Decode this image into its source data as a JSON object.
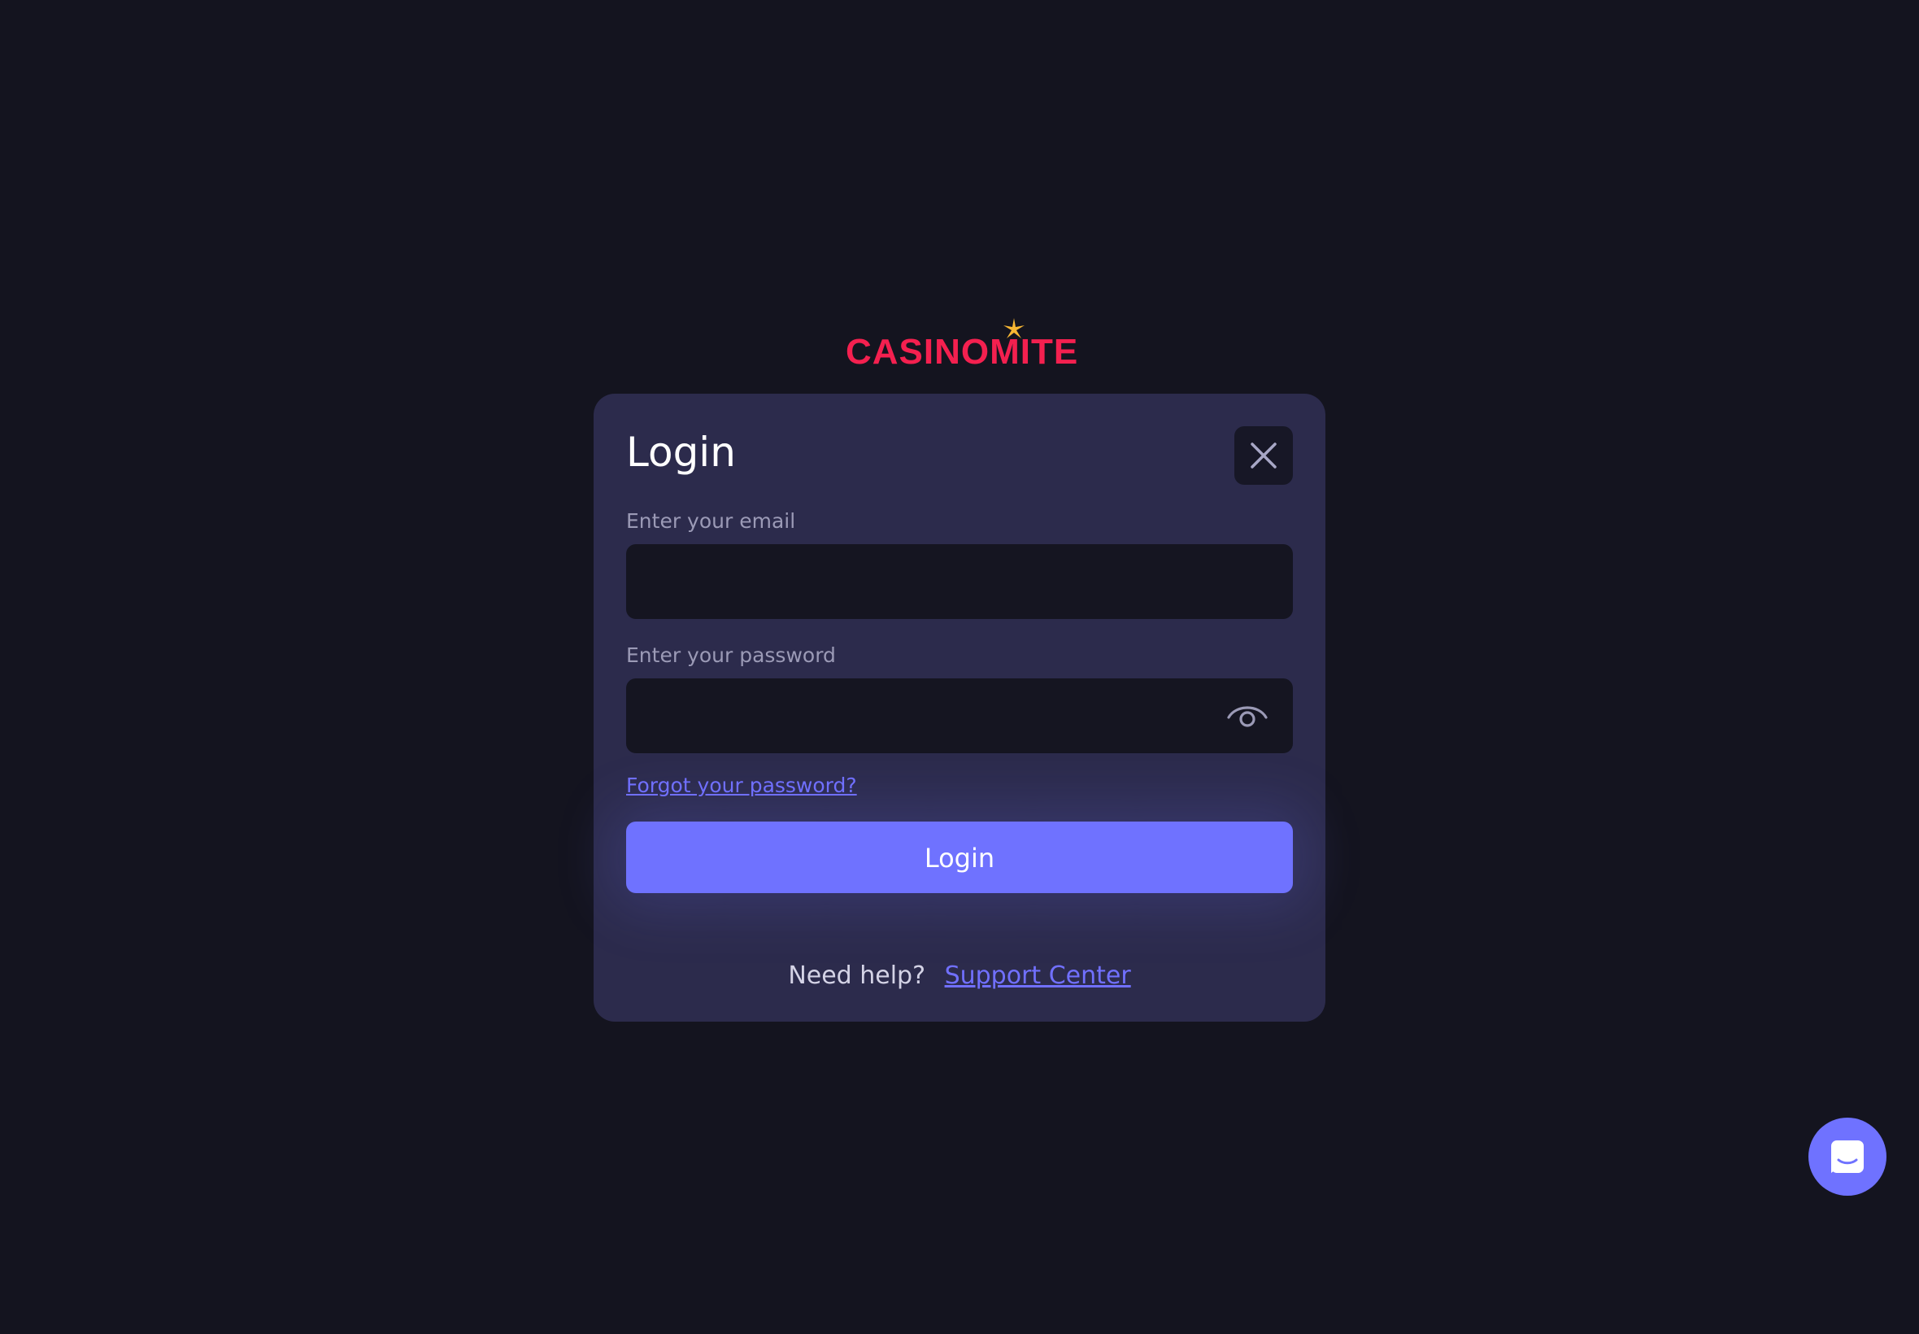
{
  "brand": {
    "logo_text": "CASINOMITE",
    "logo_color": "#f4204f",
    "star_color": "#f7b733"
  },
  "login_modal": {
    "title": "Login",
    "close_icon": "close-icon",
    "email_label": "Enter your email",
    "email_value": "",
    "password_label": "Enter your password",
    "password_value": "",
    "password_toggle_icon": "eye-icon",
    "forgot_password_link": "Forgot your password?",
    "submit_label": "Login",
    "help_text": "Need help?",
    "support_link": "Support Center"
  },
  "chat": {
    "icon": "chat-icon"
  },
  "colors": {
    "background": "#14141f",
    "modal_background": "#2c2b4c",
    "input_background": "#151521",
    "accent": "#6f72ff",
    "link": "#7170ff",
    "label": "#9b9ab6"
  }
}
